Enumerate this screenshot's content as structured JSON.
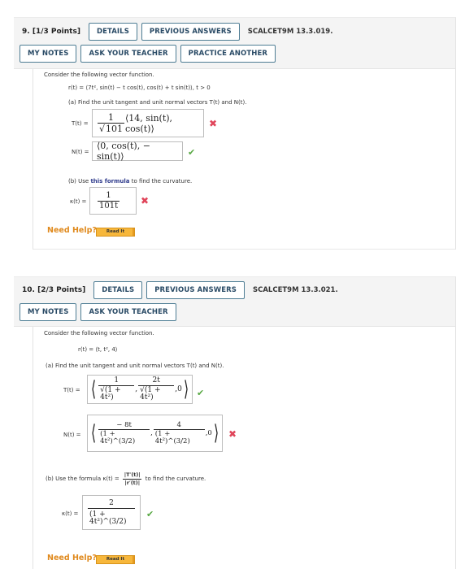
{
  "q9": {
    "number": "9.",
    "points": "[1/3 Points]",
    "buttons_row1": [
      "DETAILS",
      "PREVIOUS ANSWERS"
    ],
    "code": "SCALCET9M 13.3.019.",
    "buttons_row2": [
      "MY NOTES",
      "ASK YOUR TEACHER",
      "PRACTICE ANOTHER"
    ],
    "intro": "Consider the following vector function.",
    "function": "r(t) = ⟨7t², sin(t) − t cos(t), cos(t) + t sin(t)⟩,   t > 0",
    "part_a": "(a) Find the unit tangent and unit normal vectors T(t) and N(t).",
    "T_label": "T(t) =",
    "T_answer": {
      "coef_num": "1",
      "coef_den": "101",
      "vector": "⟨14, sin(t), cos(t)⟩",
      "status": "incorrect"
    },
    "N_label": "N(t) =",
    "N_answer": {
      "vector": "⟨0, cos(t), − sin(t)⟩",
      "status": "correct"
    },
    "part_b_prefix": "(b) Use ",
    "part_b_link": "this formula",
    "part_b_suffix": " to find the curvature.",
    "kappa_label": "κ(t) =",
    "kappa_answer": {
      "num": "1",
      "den": "101t",
      "status": "incorrect"
    },
    "need_help": "Need Help?",
    "read_it": "Read It"
  },
  "q10": {
    "number": "10.",
    "points": "[2/3 Points]",
    "buttons_row1": [
      "DETAILS",
      "PREVIOUS ANSWERS"
    ],
    "code": "SCALCET9M 13.3.021.",
    "buttons_row2": [
      "MY NOTES",
      "ASK YOUR TEACHER"
    ],
    "intro": "Consider the following vector function.",
    "function": "r(t) = ⟨t, t², 4⟩",
    "part_a": "(a)  Find the unit tangent and unit normal vectors T(t) and N(t).",
    "T_label": "T(t) =",
    "T_answer": {
      "c1_num": "1",
      "c1_den": "√(1 + 4t²)",
      "c2_num": "2t",
      "c2_den": "√(1 + 4t²)",
      "c3": "0",
      "status": "correct"
    },
    "N_label": "N(t) =",
    "N_answer": {
      "c1_num": "− 8t",
      "c1_den": "(1 + 4t²)^(3/2)",
      "c2_num": "4",
      "c2_den": "(1 + 4t²)^(3/2)",
      "c3": "0",
      "status": "incorrect"
    },
    "part_b_prefix": "(b)  Use the formula κ(t) =",
    "part_b_formula_num": "|T′(t)|",
    "part_b_formula_den": "|r′(t)|",
    "part_b_suffix": "to find the curvature.",
    "kappa_label": "κ(t) =",
    "kappa_answer": {
      "num": "2",
      "den": "(1 + 4t²)^(3/2)",
      "status": "correct"
    },
    "need_help": "Need Help?",
    "read_it": "Read It"
  },
  "icons": {
    "incorrect": "✖",
    "correct": "✔"
  },
  "colors": {
    "button_border": "#4e7d94",
    "button_text": "#2a4b66",
    "incorrect": "#e0455a",
    "correct": "#58a843",
    "help": "#e08a1e",
    "read_it_bg": "#f7b73b",
    "link": "#2f3b8c"
  }
}
